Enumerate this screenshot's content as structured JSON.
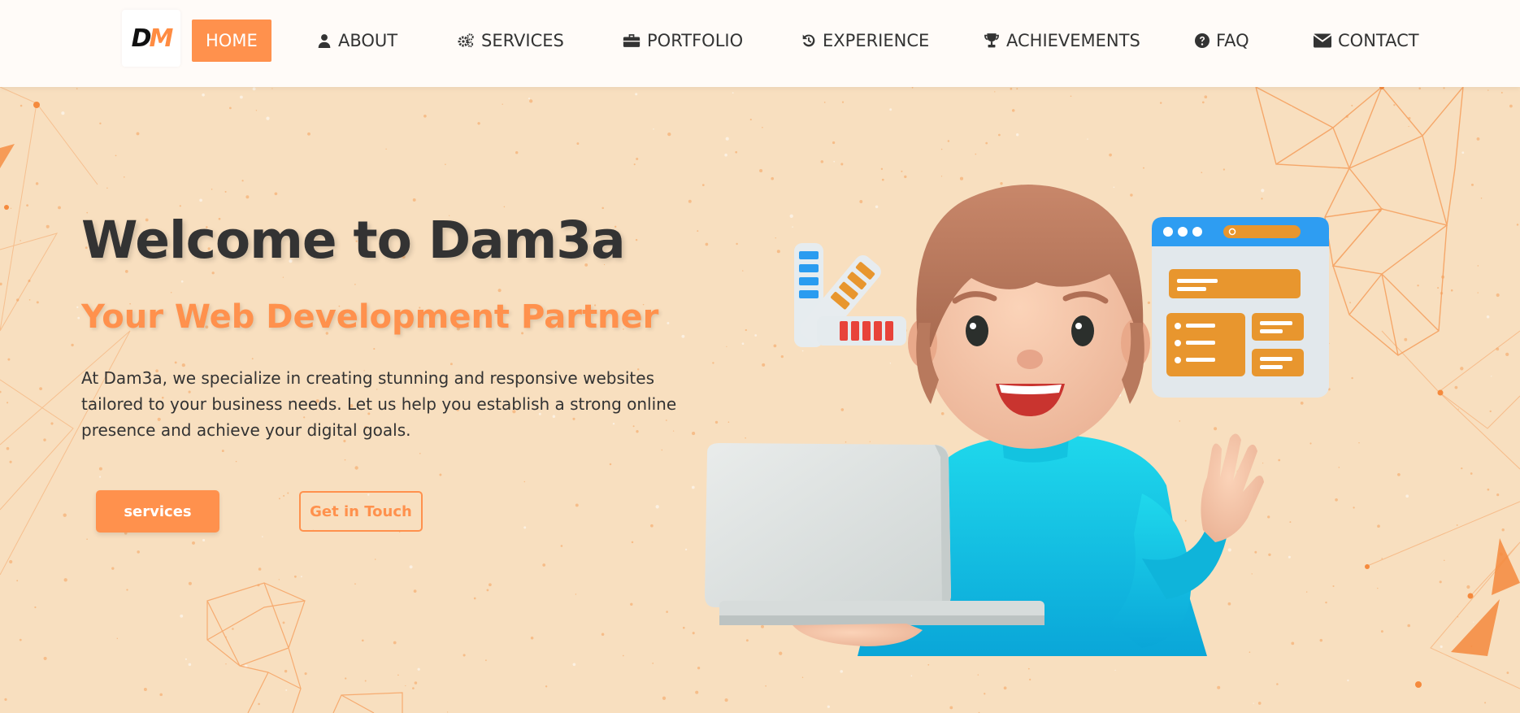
{
  "logo": {
    "text_d": "D",
    "text_m": "M"
  },
  "nav": {
    "items": [
      {
        "label": "HOME",
        "icon": "home",
        "active": true
      },
      {
        "label": "ABOUT",
        "icon": "user-icon"
      },
      {
        "label": "SERVICES",
        "icon": "gears-icon"
      },
      {
        "label": "PORTFOLIO",
        "icon": "briefcase-icon"
      },
      {
        "label": "EXPERIENCE",
        "icon": "history-icon"
      },
      {
        "label": "ACHIEVEMENTS",
        "icon": "trophy-icon"
      },
      {
        "label": "FAQ",
        "icon": "question-circle-icon"
      },
      {
        "label": "CONTACT",
        "icon": "envelope-icon"
      }
    ]
  },
  "hero": {
    "title": "Welcome to Dam3a",
    "subtitle": "Your Web Development Partner",
    "description": "At Dam3a, we specialize in creating stunning and responsive websites tailored to your business needs. Let us help you establish a strong online presence and achieve your digital goals.",
    "primary_button": "services",
    "secondary_button": "Get in Touch"
  },
  "colors": {
    "accent": "#ff914d",
    "background": "#f8dfbf",
    "navbar": "#fffbf8",
    "text": "#333333"
  }
}
